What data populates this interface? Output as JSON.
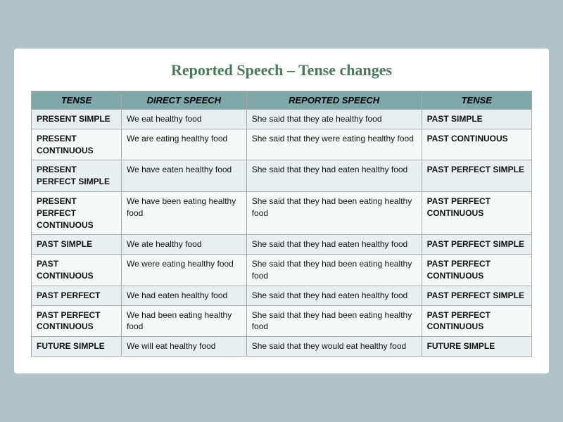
{
  "title": "Reported Speech – Tense changes",
  "table": {
    "headers": [
      "TENSE",
      "DIRECT SPEECH",
      "REPORTED SPEECH",
      "TENSE"
    ],
    "rows": [
      {
        "tense_left": "PRESENT SIMPLE",
        "direct": "We eat healthy food",
        "reported": "She said that they ate healthy food",
        "tense_right": "PAST SIMPLE"
      },
      {
        "tense_left": "PRESENT CONTINUOUS",
        "direct": "We are eating healthy food",
        "reported": "She said that they were eating healthy food",
        "tense_right": "PAST CONTINUOUS"
      },
      {
        "tense_left": "PRESENT PERFECT SIMPLE",
        "direct": "We have eaten healthy food",
        "reported": "She said that they had eaten healthy food",
        "tense_right": "PAST PERFECT SIMPLE"
      },
      {
        "tense_left": "PRESENT PERFECT CONTINUOUS",
        "direct": "We have been eating healthy food",
        "reported": "She said that they had been eating  healthy food",
        "tense_right": "PAST PERFECT CONTINUOUS"
      },
      {
        "tense_left": "PAST SIMPLE",
        "direct": "We ate healthy food",
        "reported": "She said that they had eaten healthy food",
        "tense_right": "PAST PERFECT SIMPLE"
      },
      {
        "tense_left": "PAST CONTINUOUS",
        "direct": "We were eating healthy food",
        "reported": "She said that they had been eating healthy food",
        "tense_right": "PAST PERFECT CONTINUOUS"
      },
      {
        "tense_left": "PAST PERFECT",
        "direct": "We had eaten healthy food",
        "reported": "She said that they had eaten healthy food",
        "tense_right": "PAST PERFECT SIMPLE"
      },
      {
        "tense_left": "PAST PERFECT CONTINUOUS",
        "direct": "We had been eating healthy food",
        "reported": "She said that they had been eating  healthy food",
        "tense_right": "PAST PERFECT CONTINUOUS"
      },
      {
        "tense_left": "FUTURE SIMPLE",
        "direct": "We will eat healthy food",
        "reported": "She said that they would eat healthy food",
        "tense_right": "FUTURE SIMPLE"
      }
    ]
  }
}
